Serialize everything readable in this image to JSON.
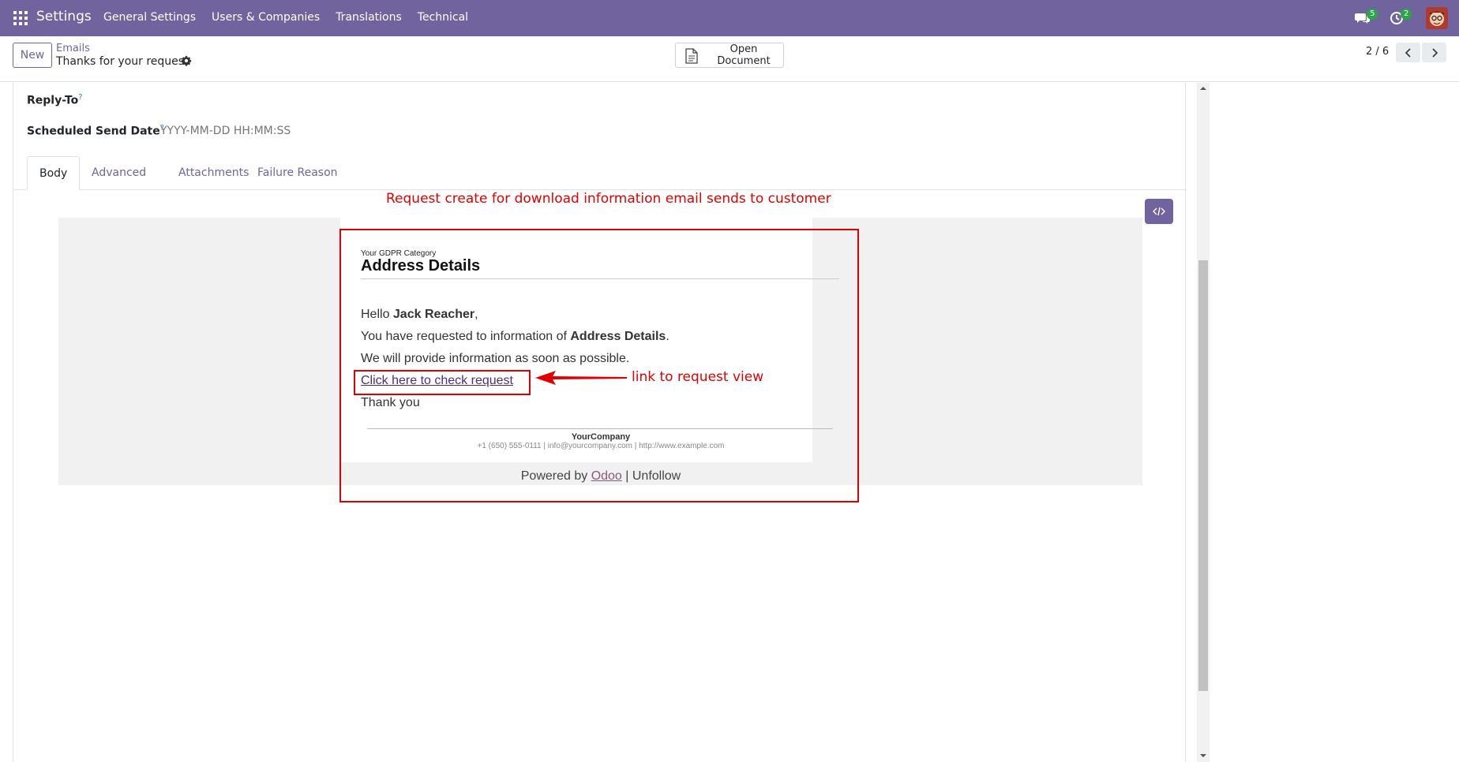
{
  "navbar": {
    "brand": "Settings",
    "menu": [
      "General Settings",
      "Users & Companies",
      "Translations",
      "Technical"
    ],
    "messages_badge": "5",
    "activities_badge": "2"
  },
  "control": {
    "new_label": "New",
    "breadcrumb_parent": "Emails",
    "breadcrumb_current": "Thanks for your request",
    "open_document_label": "Open Document",
    "pager": "2 / 6"
  },
  "form": {
    "reply_to_label": "Reply-To",
    "scheduled_label": "Scheduled Send Date",
    "scheduled_placeholder": "YYYY-MM-DD HH:MM:SS",
    "help_mark": "?",
    "tabs": [
      "Body",
      "Advanced",
      "Attachments",
      "Failure Reason"
    ]
  },
  "annotations": {
    "top": "Request create for download information email sends to customer",
    "link": "link to request view"
  },
  "email": {
    "category": "Your GDPR Category",
    "title": "Address Details",
    "hello_prefix": "Hello ",
    "customer_name": "Jack Reacher",
    "hello_suffix": ",",
    "requested_prefix": "You have requested to information of ",
    "requested_item": "Address Details",
    "requested_suffix": ".",
    "provide_line": "We will provide information as soon as possible.",
    "link_text": "Click here to check request",
    "thanks": "Thank you",
    "company": "YourCompany",
    "contact": "+1 (650) 555-0111 | info@yourcompany.com | http://www.example.com",
    "powered_prefix": "Powered by ",
    "powered_link": "Odoo",
    "powered_suffix": " | Unfollow"
  },
  "colors": {
    "brand": "#71639e",
    "annotation": "#e00000",
    "badge": "#28a745"
  }
}
